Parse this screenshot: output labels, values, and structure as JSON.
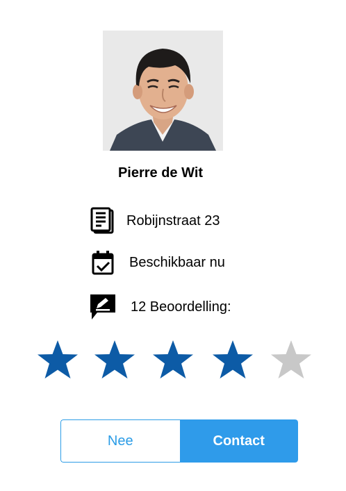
{
  "profile": {
    "name": "Pierre de Wit",
    "address": "Robijnstraat 23",
    "availability": "Beschikbaar nu",
    "reviews": "12 Beoordelling:"
  },
  "rating": {
    "value": 4,
    "max": 5,
    "filled_color": "#0d5ba6",
    "empty_color": "#c8c8c8"
  },
  "icons": {
    "address": "notebook-icon",
    "availability": "calendar-check-icon",
    "reviews": "chat-pen-icon"
  },
  "actions": {
    "no_label": "Nee",
    "contact_label": "Contact",
    "accent_color": "#2f9bea"
  }
}
